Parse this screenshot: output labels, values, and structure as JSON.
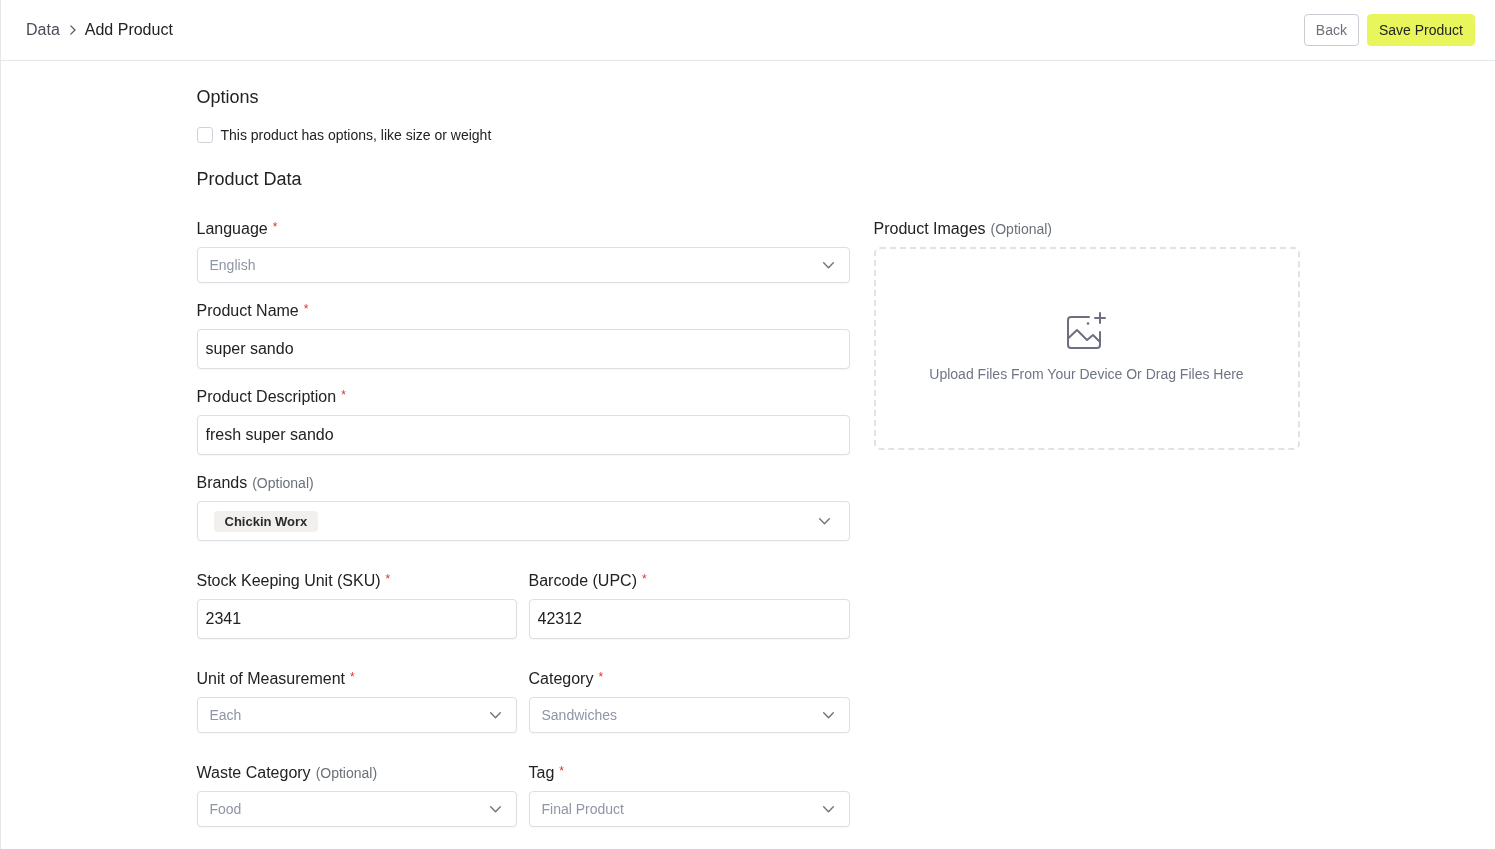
{
  "breadcrumb": [
    {
      "label": "Data",
      "current": false
    },
    {
      "label": "Add Product",
      "current": true
    }
  ],
  "actions": [
    {
      "label": "Back",
      "kind": "secondary"
    },
    {
      "label": "Save Product",
      "kind": "primary"
    }
  ],
  "options_section": {
    "title": "Options",
    "checkbox": {
      "label": "This product has options, like size or weight",
      "checked": false
    }
  },
  "product_data": {
    "title": "Product Data",
    "rows": [
      {
        "fields": [
          {
            "kind": "select",
            "label": "Language",
            "marker": "*",
            "value": "English"
          }
        ]
      },
      {
        "fields": [
          {
            "kind": "text",
            "label": "Product Name",
            "marker": "*",
            "value": "super sando"
          }
        ]
      },
      {
        "fields": [
          {
            "kind": "text",
            "label": "Product Description",
            "marker": "*",
            "value": "fresh super sando"
          }
        ]
      },
      {
        "fields": [
          {
            "kind": "multiselect",
            "label": "Brands",
            "note": "(Optional)",
            "chips": [
              "Chickin Worx"
            ]
          }
        ]
      },
      {
        "fields": [
          {
            "kind": "text",
            "label": "Stock Keeping Unit (SKU)",
            "marker": "*",
            "value": "2341"
          },
          {
            "kind": "text",
            "label": "Barcode (UPC)",
            "marker": "*",
            "value": "42312"
          }
        ]
      },
      {
        "fields": [
          {
            "kind": "select",
            "label": "Unit of Measurement",
            "marker": "*",
            "value": "Each"
          },
          {
            "kind": "select",
            "label": "Category",
            "marker": "*",
            "value": "Sandwiches"
          }
        ]
      },
      {
        "fields": [
          {
            "kind": "select",
            "label": "Waste Category",
            "note": "(Optional)",
            "value": "Food"
          },
          {
            "kind": "select",
            "label": "Tag",
            "marker": "*",
            "value": "Final Product"
          }
        ]
      }
    ]
  },
  "product_images": {
    "label": "Product Images",
    "note": "(Optional)",
    "upload_text": "Upload Files From Your Device Or Drag Files Here"
  }
}
